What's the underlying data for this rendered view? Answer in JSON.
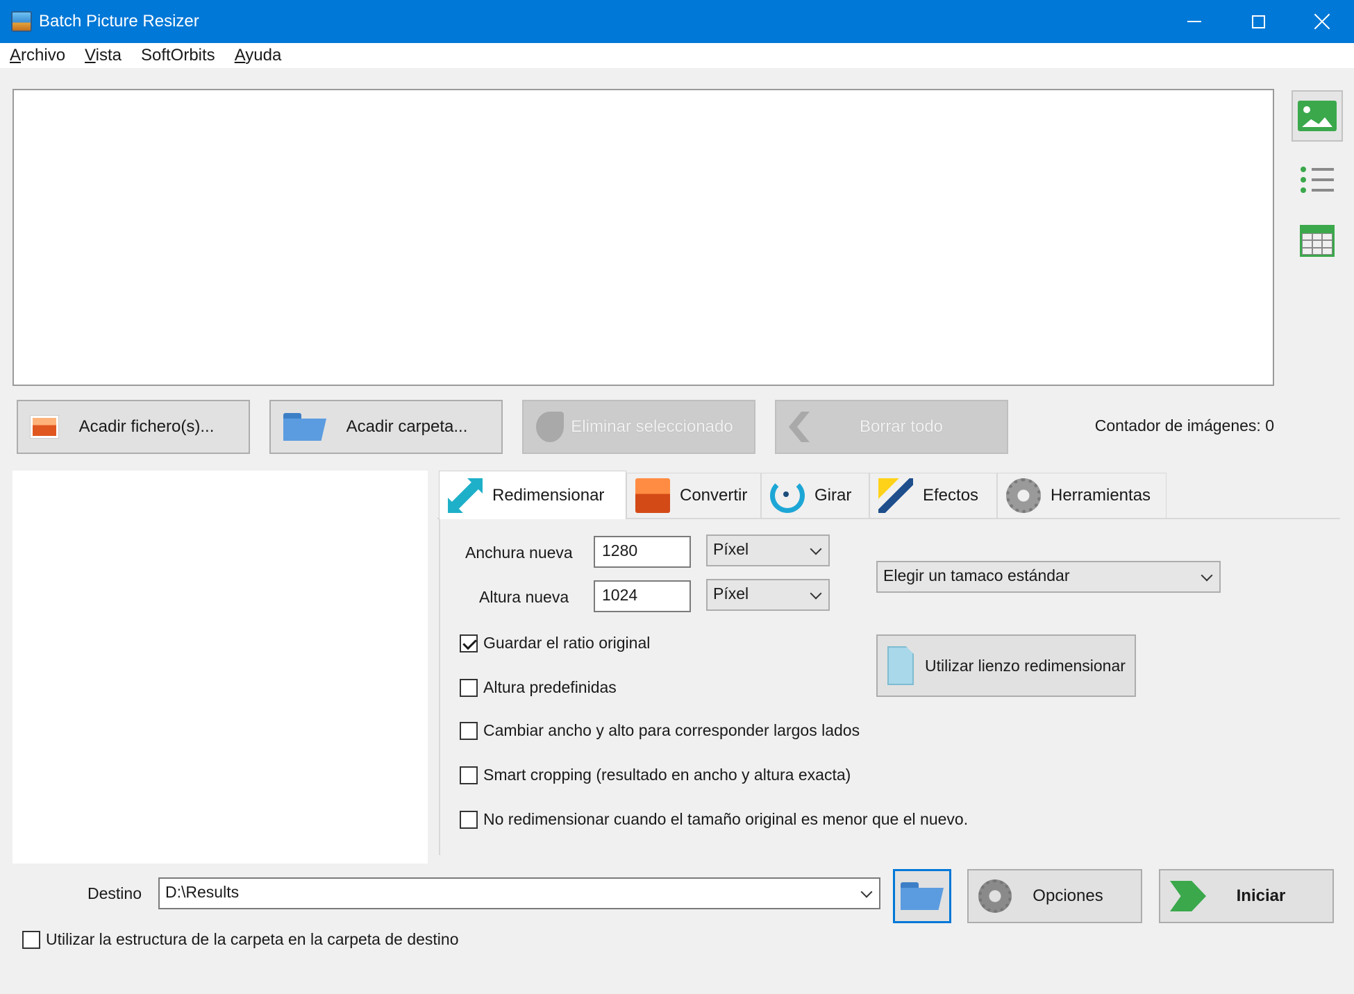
{
  "window": {
    "title": "Batch Picture Resizer"
  },
  "menu": {
    "items": [
      {
        "label": "Archivo",
        "mnemonic": "A",
        "rest": "rchivo"
      },
      {
        "label": "Vista",
        "mnemonic": "V",
        "rest": "ista"
      },
      {
        "label": "SoftOrbits",
        "mnemonic": "",
        "rest": "SoftOrbits"
      },
      {
        "label": "Ayuda",
        "mnemonic": "A",
        "rest": "yuda"
      }
    ]
  },
  "file_buttons": {
    "add_files": "Acadir fichero(s)...",
    "add_folder": "Acadir carpeta...",
    "remove_selected": "Eliminar seleccionado",
    "clear_all": "Borrar todo"
  },
  "counter": "Contador de imágenes: 0",
  "tabs": [
    {
      "label": "Redimensionar",
      "icon": "resize-icon",
      "active": true
    },
    {
      "label": "Convertir",
      "icon": "convert-icon",
      "active": false
    },
    {
      "label": "Girar",
      "icon": "rotate-icon",
      "active": false
    },
    {
      "label": "Efectos",
      "icon": "effects-icon",
      "active": false
    },
    {
      "label": "Herramientas",
      "icon": "tools-icon",
      "active": false
    }
  ],
  "resize": {
    "width_label": "Anchura nueva",
    "width_value": "1280",
    "width_unit": "Píxel",
    "height_label": "Altura nueva",
    "height_value": "1024",
    "height_unit": "Píxel",
    "standard_size": "Elegir un tamaco estándar",
    "canvas_button": "Utilizar lienzo redimensionar",
    "options": [
      {
        "label": "Guardar el ratio original",
        "checked": true
      },
      {
        "label": "Altura predefinidas",
        "checked": false
      },
      {
        "label": "Cambiar ancho y alto para corresponder largos lados",
        "checked": false
      },
      {
        "label": "Smart cropping (resultado en ancho y altura exacta)",
        "checked": false
      },
      {
        "label": "No redimensionar cuando el tamaño original es menor que el nuevo.",
        "checked": false
      }
    ]
  },
  "destination": {
    "label": "Destino",
    "value": "D:\\Results",
    "keep_structure_label": "Utilizar la estructura de la carpeta en la carpeta de destino",
    "keep_structure_checked": false
  },
  "actions": {
    "options": "Opciones",
    "start": "Iniciar"
  },
  "colors": {
    "titlebar": "#0078d7",
    "accent_green": "#3aa84b"
  }
}
